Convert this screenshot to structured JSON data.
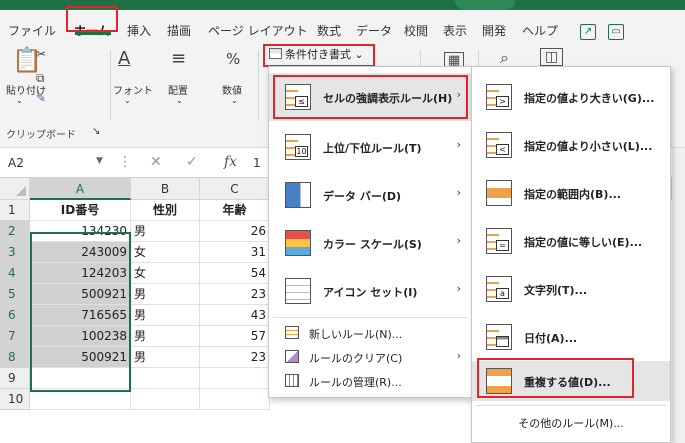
{
  "ribbon_tabs": [
    "ファイル",
    "ホーム",
    "挿入",
    "描画",
    "ページ レイアウト",
    "数式",
    "データ",
    "校閲",
    "表示",
    "開発",
    "ヘルプ"
  ],
  "ribbon": {
    "clipboard_paste": "貼り付け",
    "font_label": "フォント",
    "align_label": "配置",
    "number_label": "数値",
    "percent_icon": "%",
    "clipboard_group": "クリップボード",
    "conditional_format": "条件付き書式"
  },
  "formula_bar": {
    "name_box": "A2",
    "fx": "fx",
    "value_fragment": "1"
  },
  "grid": {
    "columns": [
      "A",
      "B",
      "C"
    ],
    "rows": [
      "1",
      "2",
      "3",
      "4",
      "5",
      "6",
      "7",
      "8",
      "9",
      "10"
    ],
    "header_row": [
      "ID番号",
      "性別",
      "年齢"
    ],
    "data": [
      [
        "134230",
        "男",
        "26"
      ],
      [
        "243009",
        "女",
        "31"
      ],
      [
        "124203",
        "女",
        "54"
      ],
      [
        "500921",
        "男",
        "23"
      ],
      [
        "716565",
        "男",
        "43"
      ],
      [
        "100238",
        "男",
        "57"
      ],
      [
        "500921",
        "男",
        "23"
      ]
    ]
  },
  "menu_main": {
    "items": [
      {
        "label": "セルの強調表示ルール(H)",
        "arrow": "›"
      },
      {
        "label": "上位/下位ルール(T)",
        "arrow": "›",
        "tag": "10"
      },
      {
        "label": "データ バー(D)",
        "arrow": "›"
      },
      {
        "label": "カラー スケール(S)",
        "arrow": "›"
      },
      {
        "label": "アイコン セット(I)",
        "arrow": "›"
      }
    ],
    "bottom_items": [
      {
        "label": "新しいルール(N)..."
      },
      {
        "label": "ルールのクリア(C)",
        "arrow": "›"
      },
      {
        "label": "ルールの管理(R)..."
      }
    ]
  },
  "menu_sub": {
    "items": [
      {
        "label": "指定の値より大きい(G)...",
        "tag": ">"
      },
      {
        "label": "指定の値より小さい(L)...",
        "tag": "<"
      },
      {
        "label": "指定の範囲内(B)..."
      },
      {
        "label": "指定の値に等しい(E)...",
        "tag": "="
      },
      {
        "label": "文字列(T)...",
        "tag": "a"
      },
      {
        "label": "日付(A)..."
      },
      {
        "label": "重複する値(D)..."
      }
    ],
    "more": "その他のルール(M)..."
  },
  "colors": {
    "excel_green": "#1e7145",
    "highlight_red": "#e0252b",
    "bar_orange": "#f0a046"
  }
}
